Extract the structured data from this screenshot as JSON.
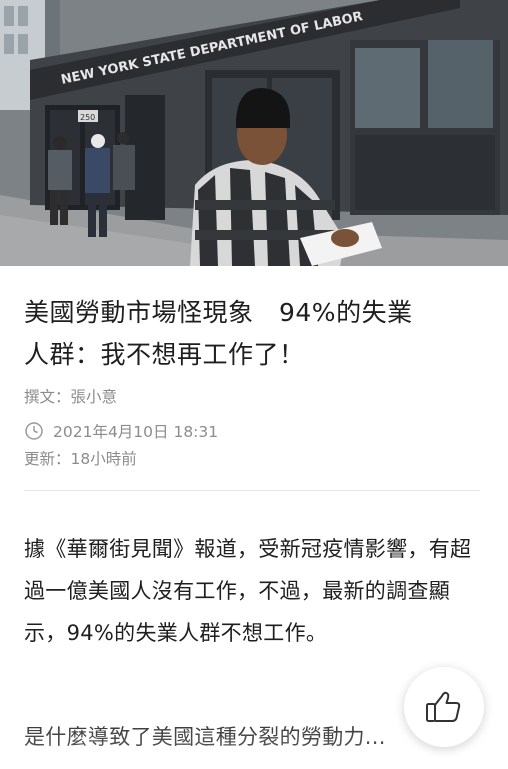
{
  "hero": {
    "sign_text": "NEW YORK STATE DEPARTMENT OF LABOR",
    "door_number": "250"
  },
  "article": {
    "headline_line1": "美國勞動市場怪現象　94%的失業",
    "headline_line2": "人群：我不想再工作了！",
    "byline": "撰文：張小意",
    "published": "2021年4月10日 18:31",
    "updated": "更新：18小時前",
    "paragraph1": "據《華爾街見聞》報道，受新冠疫情影響，有超過一億美國人沒有工作，不過，最新的調查顯示，94%的失業人群不想工作。",
    "paragraph2": "是什麼導致了美國這種分裂的勞動力..."
  },
  "icons": {
    "clock": "clock-icon",
    "like": "thumbs-up-icon"
  }
}
